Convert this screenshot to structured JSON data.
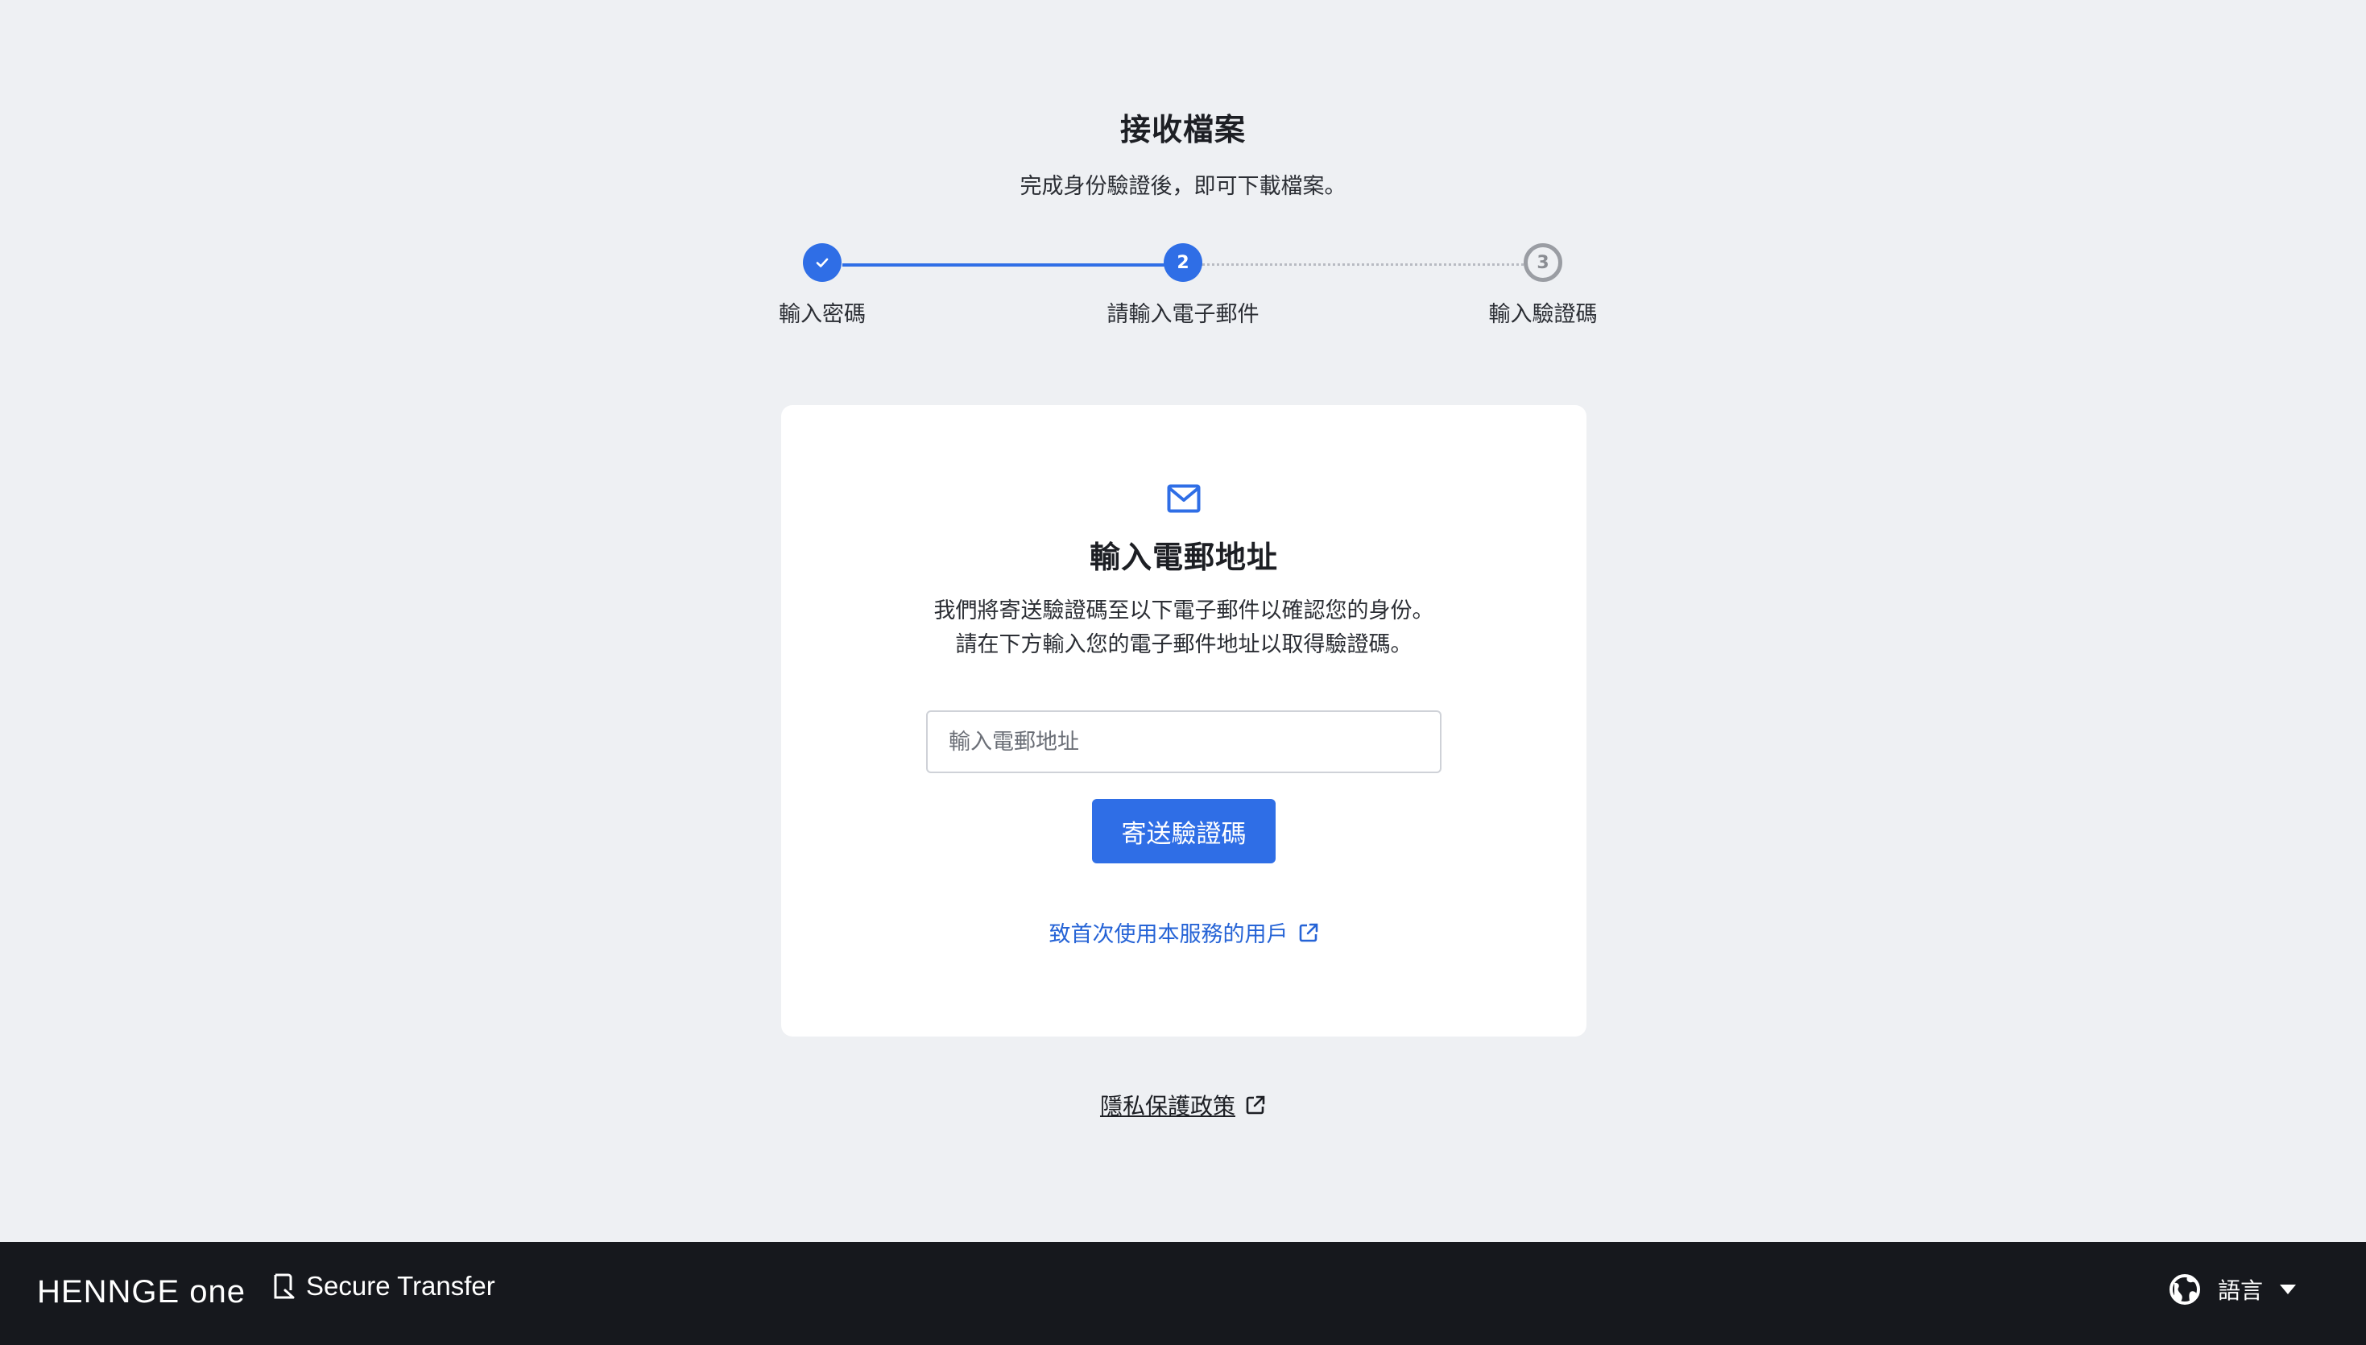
{
  "header": {
    "title": "接收檔案",
    "subtitle": "完成身份驗證後，即可下載檔案。"
  },
  "stepper": {
    "steps": [
      {
        "label": "輸入密碼",
        "state": "done"
      },
      {
        "label": "請輸入電子郵件",
        "number": "2",
        "state": "active"
      },
      {
        "label": "輸入驗證碼",
        "number": "3",
        "state": "pending"
      }
    ]
  },
  "card": {
    "icon": "mail-icon",
    "title": "輸入電郵地址",
    "desc_line1": "我們將寄送驗證碼至以下電子郵件以確認您的身份。",
    "desc_line2": "請在下方輸入您的電子郵件地址以取得驗證碼。",
    "email_placeholder": "輸入電郵地址",
    "email_value": "",
    "send_label": "寄送驗證碼",
    "first_time_link": "致首次使用本服務的用戶"
  },
  "privacy_link": "隱私保護政策",
  "footer": {
    "logo": "HENNGE one",
    "product": "Secure Transfer",
    "language_label": "語言"
  },
  "colors": {
    "accent": "#2f6ee6",
    "link": "#2563d6",
    "background": "#eef0f3",
    "footer": "#16181d"
  }
}
